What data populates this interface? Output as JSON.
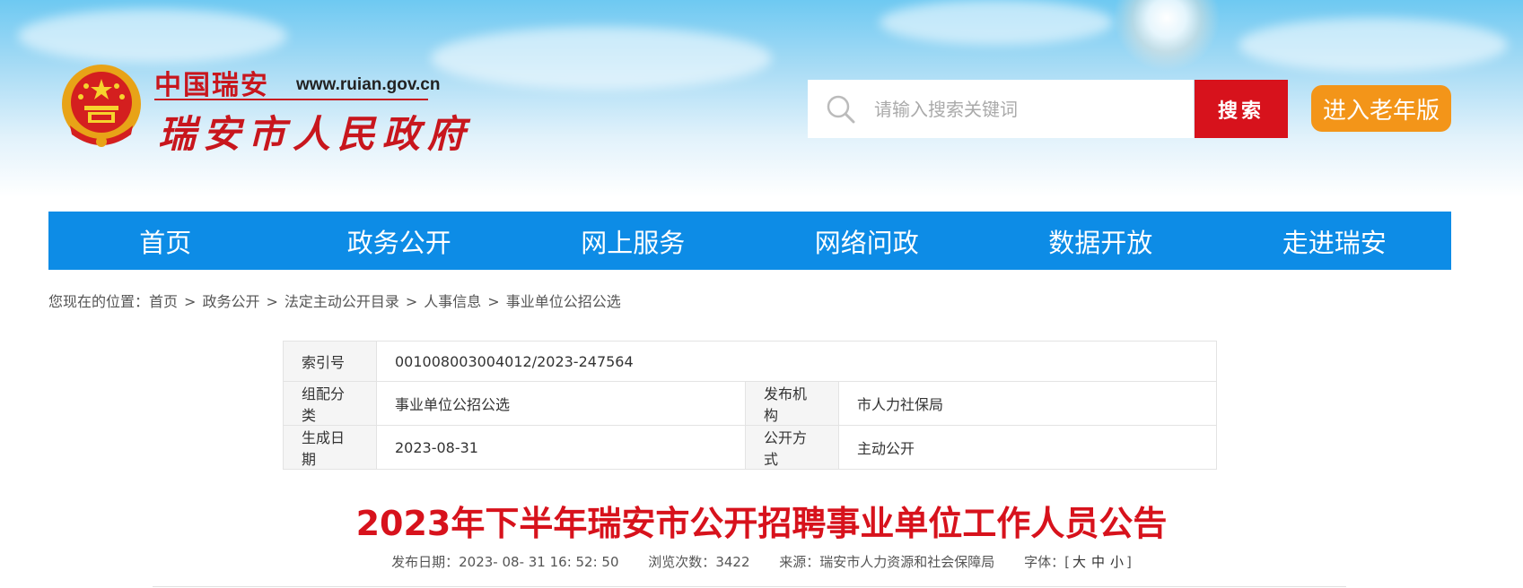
{
  "header": {
    "logo_small": "中国瑞安",
    "logo_url": "www.ruian.gov.cn",
    "logo_big": "瑞安市人民政府"
  },
  "search": {
    "placeholder": "请输入搜索关键词",
    "button_label": "搜索"
  },
  "elder_button": "进入老年版",
  "nav": {
    "items": [
      "首页",
      "政务公开",
      "网上服务",
      "网络问政",
      "数据开放",
      "走进瑞安"
    ]
  },
  "breadcrumb": {
    "prefix": "您现在的位置：",
    "items": [
      "首页",
      "政务公开",
      "法定主动公开目录",
      "人事信息",
      "事业单位公招公选"
    ],
    "separator": ">"
  },
  "info": {
    "index_label": "索引号",
    "index_value": "001008003004012/2023-247564",
    "category_label": "组配分类",
    "category_value": "事业单位公招公选",
    "org_label": "发布机构",
    "org_value": "市人力社保局",
    "date_label": "生成日期",
    "date_value": "2023-08-31",
    "method_label": "公开方式",
    "method_value": "主动公开"
  },
  "article": {
    "title": "2023年下半年瑞安市公开招聘事业单位工作人员公告",
    "publish_label": "发布日期：",
    "publish_value": "2023- 08- 31 16: 52: 50",
    "views_label": "浏览次数：",
    "views_value": "3422",
    "source_label": "来源：",
    "source_value": "瑞安市人力资源和社会保障局",
    "fontsize_label": "字体：",
    "fontsize_open": "[",
    "fontsize_large": "大",
    "fontsize_medium": "中",
    "fontsize_small": "小",
    "fontsize_close": "]"
  },
  "colors": {
    "nav_bg": "#0d8ce6",
    "search_btn": "#d7121c",
    "elder_btn": "#f39519",
    "title_red": "#d7121c"
  }
}
